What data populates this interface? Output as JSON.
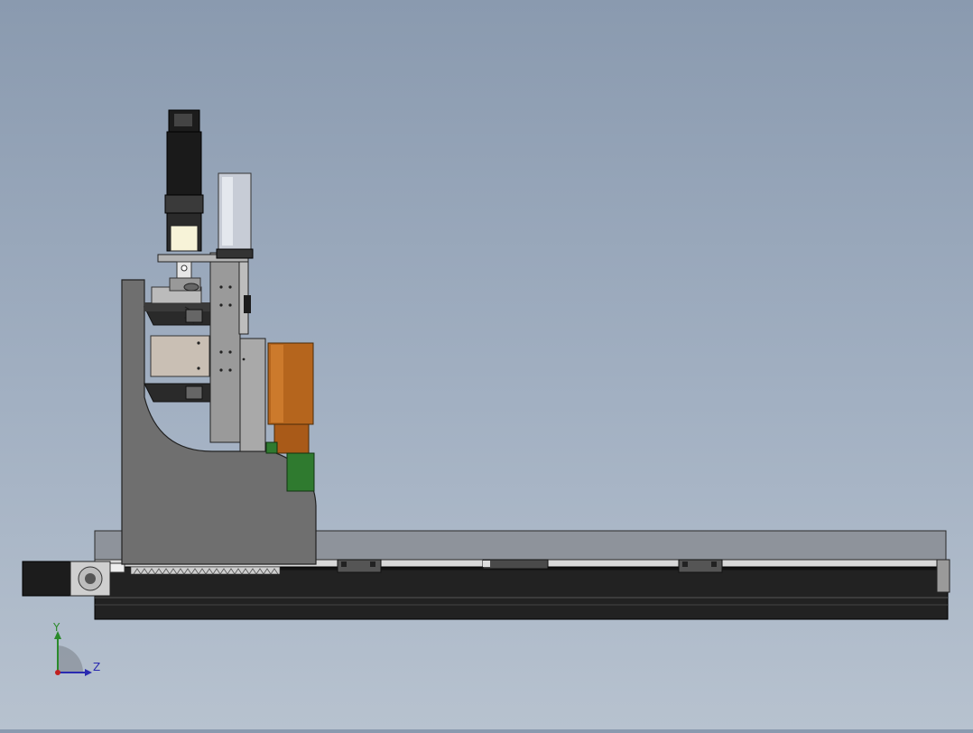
{
  "view": {
    "background_top": "#8a9aaf",
    "background_bottom": "#b7c2cf"
  },
  "triad": {
    "y_label": "Y",
    "z_label": "Z",
    "y_color": "#2a8a2a",
    "z_color": "#2a2ab0",
    "x_color": "#c02020"
  },
  "materials": {
    "motor_black": "#1c1c1c",
    "frame_gray": "#6f6f6f",
    "plate_gray": "#9a9a9a",
    "rail_gray": "#8e939b",
    "copper": "#b5651d",
    "green_block": "#2f7a2f",
    "base_black": "#222222"
  }
}
